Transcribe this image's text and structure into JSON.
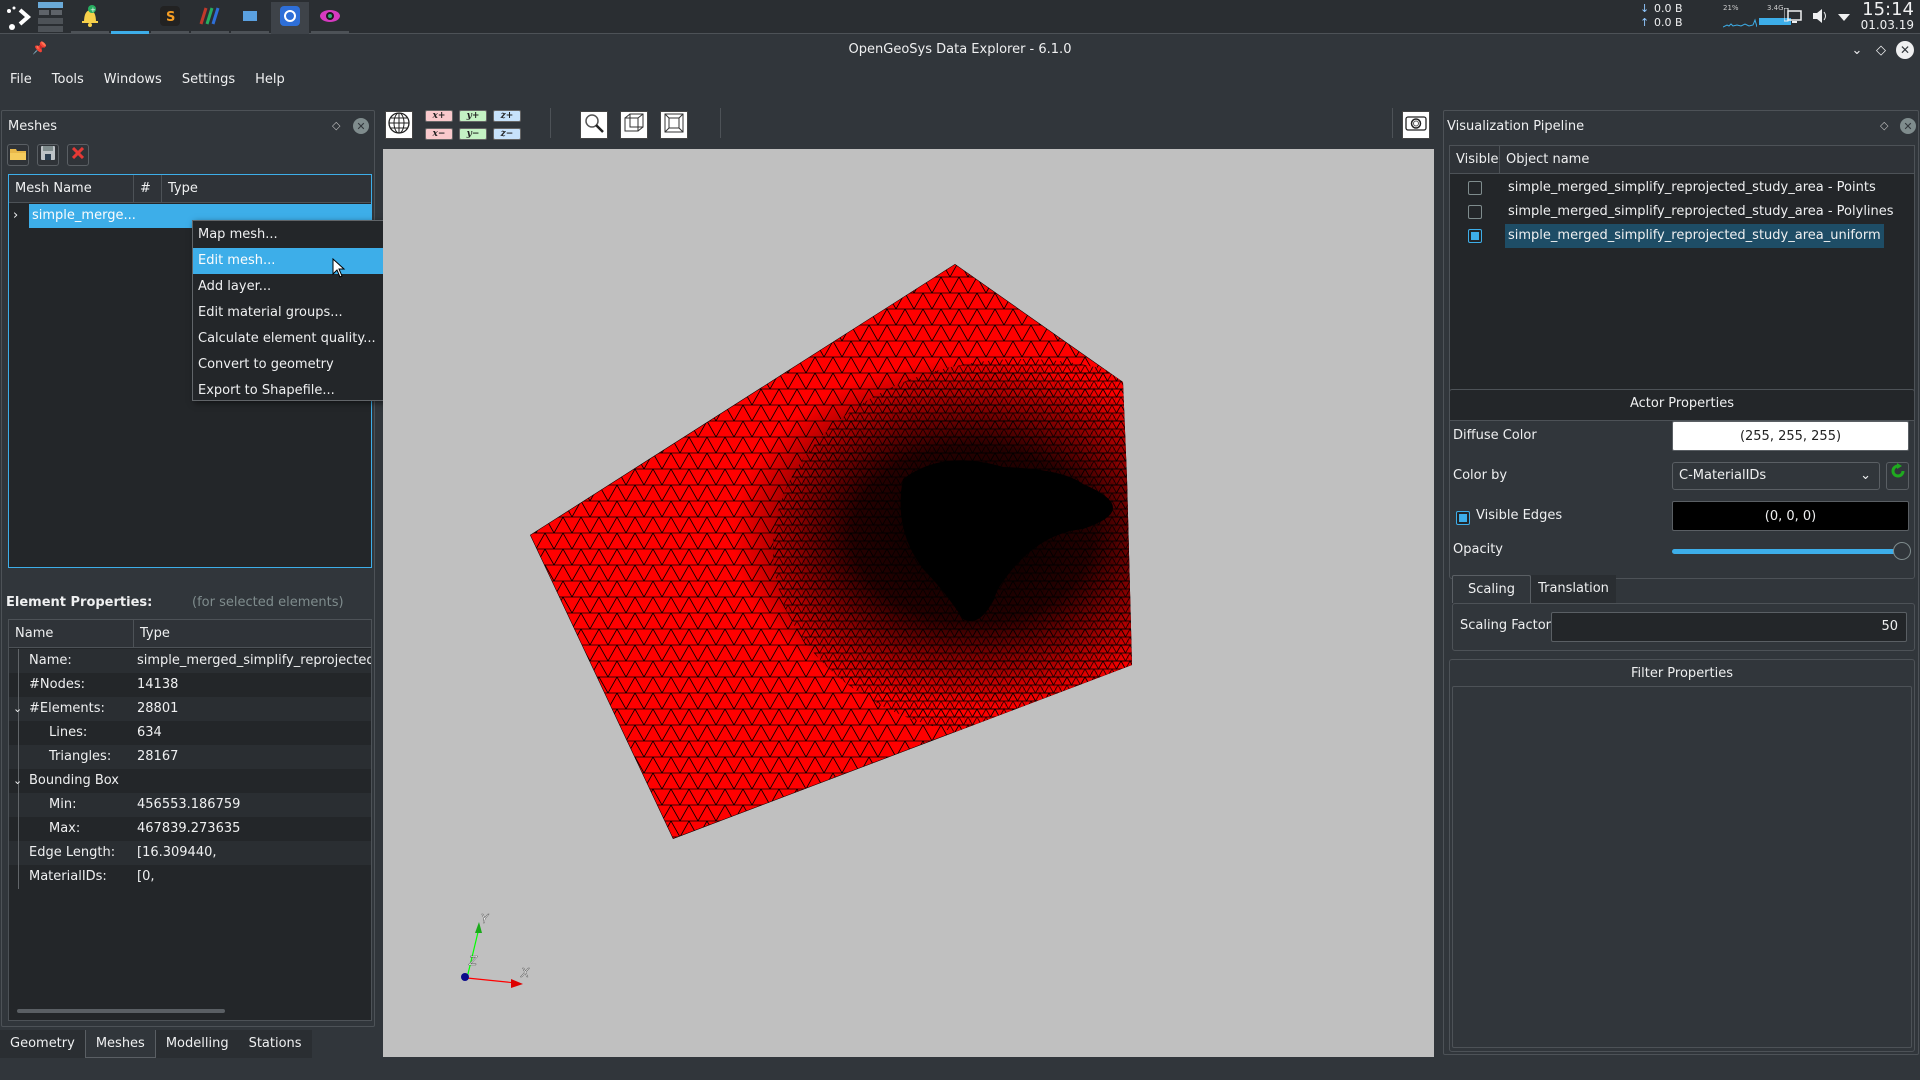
{
  "taskbar": {
    "launcher_icon": "application-launcher-icon",
    "pager_icon": "virtual-desktop-pager-icon",
    "tasks": [
      {
        "name": "notifications-app",
        "icon": "bell-icon"
      },
      {
        "name": "sublime-text",
        "icon": "sublime-icon"
      },
      {
        "name": "paraview",
        "icon": "paraview-icon"
      },
      {
        "name": "display-app",
        "icon": "monitor-icon"
      },
      {
        "name": "opengeosys",
        "icon": "ogs-icon"
      },
      {
        "name": "eye-app",
        "icon": "eye-icon"
      }
    ],
    "net_down": "0.0 B",
    "net_up": "0.0 B",
    "cpu_label": "21%",
    "mem_label": "3.4G",
    "time": "15:14",
    "date": "01.03.19"
  },
  "window": {
    "title": "OpenGeoSys Data Explorer - 6.1.0"
  },
  "menu": [
    "File",
    "Tools",
    "Windows",
    "Settings",
    "Help"
  ],
  "meshes_panel": {
    "title": "Meshes",
    "columns": [
      "Mesh Name",
      "#",
      "Type"
    ],
    "rows": [
      {
        "name": "simple_merge...",
        "selected": true
      }
    ]
  },
  "context_menu": {
    "items": [
      {
        "label": "Map mesh...",
        "highlighted": false
      },
      {
        "label": "Edit mesh...",
        "highlighted": true
      },
      {
        "label": "Add layer...",
        "highlighted": false
      },
      {
        "label": "Edit material groups...",
        "highlighted": false
      },
      {
        "label": "Calculate element quality...",
        "highlighted": false
      },
      {
        "label": "Convert to geometry",
        "highlighted": false
      },
      {
        "label": "Export to Shapefile...",
        "highlighted": false
      }
    ]
  },
  "element_properties": {
    "title": "Element Properties:",
    "hint": "(for selected elements)",
    "columns": [
      "Name",
      "Type"
    ],
    "rows": [
      {
        "name": "Name:",
        "value": "simple_merged_simplify_reprojected_s",
        "level": 0
      },
      {
        "name": "#Nodes:",
        "value": "14138",
        "level": 0
      },
      {
        "name": "#Elements:",
        "value": "28801",
        "level": 0,
        "expanded": true
      },
      {
        "name": "Lines:",
        "value": "634",
        "level": 1
      },
      {
        "name": "Triangles:",
        "value": "28167",
        "level": 1
      },
      {
        "name": "Bounding Box",
        "value": "",
        "level": 0,
        "expanded": true
      },
      {
        "name": "Min:",
        "value": "456553.186759",
        "level": 1
      },
      {
        "name": "Max:",
        "value": "467839.273635",
        "level": 1
      },
      {
        "name": "Edge Length:",
        "value": "[16.309440,",
        "level": 0
      },
      {
        "name": "MaterialIDs:",
        "value": "[0,",
        "level": 0
      }
    ]
  },
  "bottom_tabs": [
    {
      "label": "Geometry",
      "active": false
    },
    {
      "label": "Meshes",
      "active": true
    },
    {
      "label": "Modelling",
      "active": false
    },
    {
      "label": "Stations",
      "active": false
    }
  ],
  "view_toolbar": {
    "axis_buttons": [
      "x+",
      "y+",
      "z+",
      "x−",
      "y−",
      "z−"
    ]
  },
  "axes": {
    "x": "X",
    "y": "Y",
    "z": "Z"
  },
  "pipeline": {
    "title": "Visualization Pipeline",
    "columns": [
      "Visible",
      "Object name"
    ],
    "rows": [
      {
        "name": "simple_merged_simplify_reprojected_study_area - Points",
        "visible": false,
        "selected": false
      },
      {
        "name": "simple_merged_simplify_reprojected_study_area - Polylines",
        "visible": false,
        "selected": false
      },
      {
        "name": "simple_merged_simplify_reprojected_study_area_uniform",
        "visible": true,
        "selected": true
      }
    ]
  },
  "actor_properties": {
    "title": "Actor Properties",
    "diffuse_label": "Diffuse Color",
    "diffuse_value": "(255, 255, 255)",
    "colorby_label": "Color by",
    "colorby_value": "C-MaterialIDs",
    "edges_label": "Visible Edges",
    "edges_checked": true,
    "edges_value": "(0, 0, 0)",
    "opacity_label": "Opacity",
    "opacity": 1.0
  },
  "transform_tabs": [
    "Scaling",
    "Translation"
  ],
  "scaling": {
    "label": "Scaling Factor",
    "value": "50"
  },
  "filter_properties": {
    "title": "Filter Properties"
  },
  "colors": {
    "accent": "#3daee9",
    "mesh_fill": "#ff0000",
    "mesh_edge": "#000000",
    "viewport_bg": "#c0c0c0"
  }
}
